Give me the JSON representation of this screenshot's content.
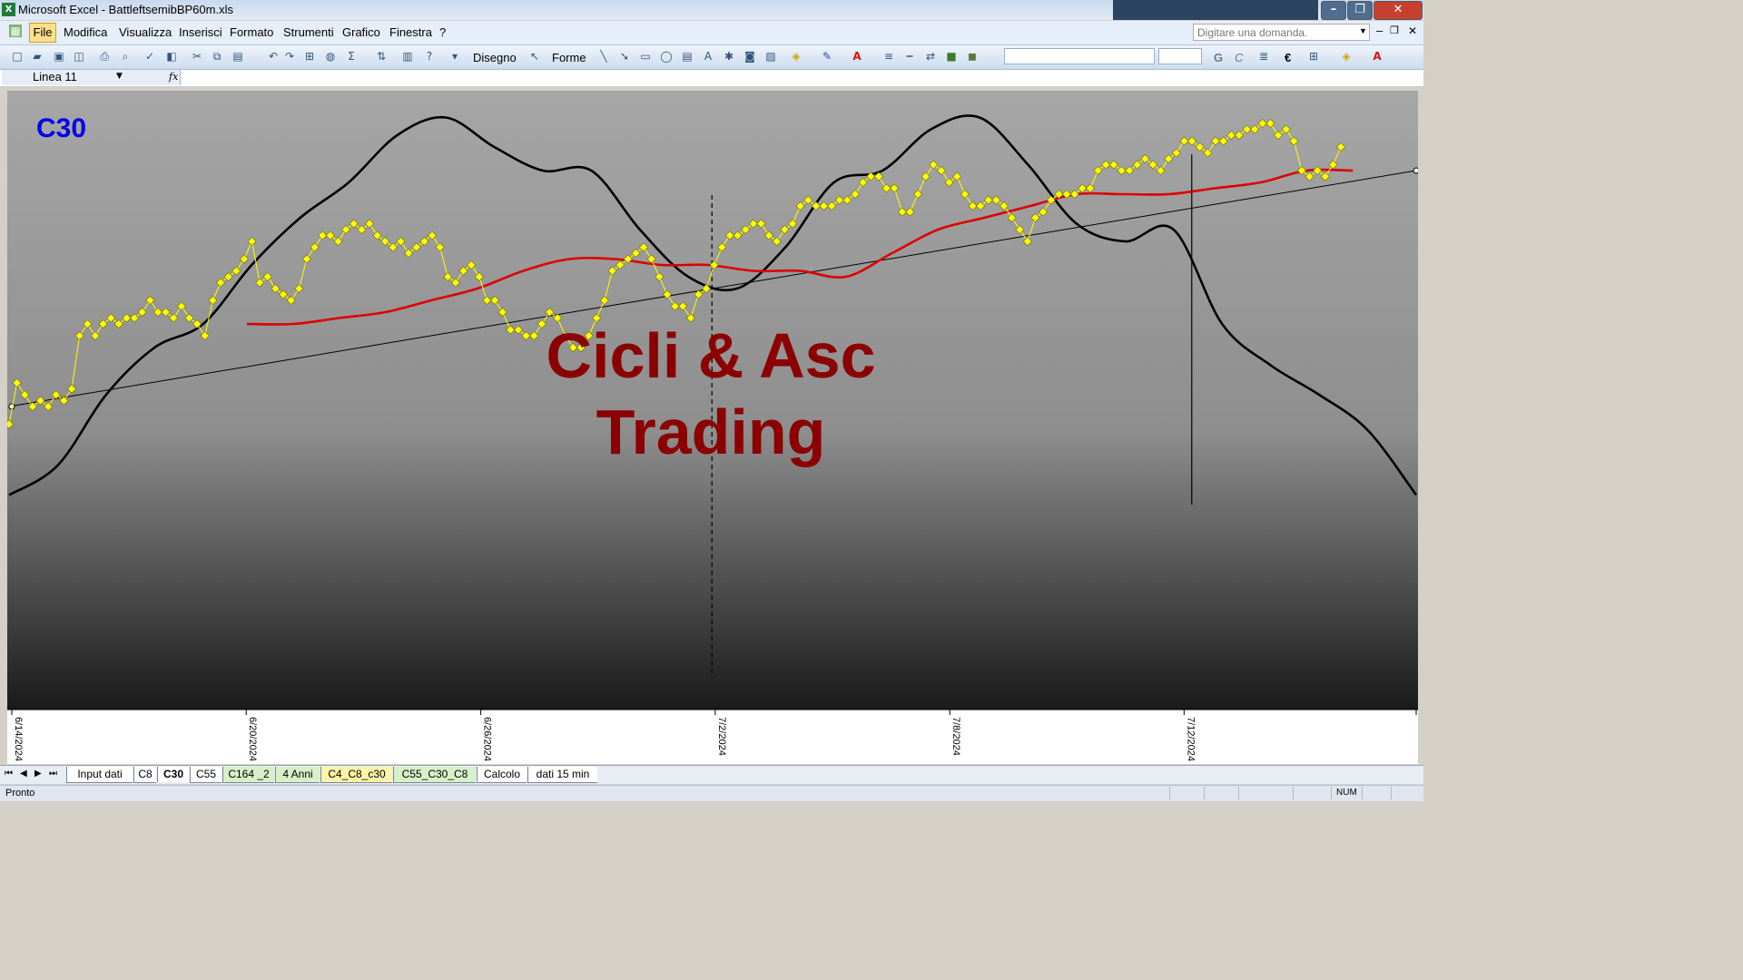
{
  "window": {
    "title": "Microsoft Excel - BattleftsemibBP60m.xls",
    "icon": "excel-icon",
    "controls": [
      "minimize-icon",
      "restore-icon",
      "close-icon"
    ]
  },
  "menubar": {
    "items": [
      "File",
      "Modifica",
      "Visualizza",
      "Inserisci",
      "Formato",
      "Strumenti",
      "Grafico",
      "Finestra",
      "?"
    ],
    "ask_placeholder": "Digitare una domanda."
  },
  "toolbar": {
    "draw_label": "Disegno",
    "shapes_label": "Forme",
    "bold_label": "G",
    "italic_label": "C",
    "euro_label": "€"
  },
  "formula_bar": {
    "name_box": "Linea 11",
    "fx_label": "fx"
  },
  "chart_data": {
    "type": "line",
    "title": "C30",
    "watermark": [
      "Cicli & Asc",
      "Trading"
    ],
    "x_tick_labels": [
      "6/14/2024",
      "6/20/2024",
      "6/26/2024",
      "7/2/2024",
      "7/8/2024",
      "7/12/2024"
    ],
    "colors": {
      "price": "#ffff00",
      "average": "#dd0000",
      "cycle": "#000000",
      "trendline": "#000000",
      "title": "#0000ee",
      "watermark": "#8b0000"
    },
    "price": [
      0.45,
      0.52,
      0.5,
      0.48,
      0.49,
      0.48,
      0.5,
      0.49,
      0.51,
      0.6,
      0.62,
      0.6,
      0.62,
      0.63,
      0.62,
      0.63,
      0.63,
      0.64,
      0.66,
      0.64,
      0.64,
      0.63,
      0.65,
      0.63,
      0.62,
      0.6,
      0.66,
      0.69,
      0.7,
      0.71,
      0.73,
      0.76,
      0.69,
      0.7,
      0.68,
      0.67,
      0.66,
      0.68,
      0.73,
      0.75,
      0.77,
      0.77,
      0.76,
      0.78,
      0.79,
      0.78,
      0.79,
      0.77,
      0.76,
      0.75,
      0.76,
      0.74,
      0.75,
      0.76,
      0.77,
      0.75,
      0.7,
      0.69,
      0.71,
      0.72,
      0.7,
      0.66,
      0.66,
      0.64,
      0.61,
      0.61,
      0.6,
      0.6,
      0.62,
      0.64,
      0.63,
      0.6,
      0.58,
      0.58,
      0.6,
      0.63,
      0.66,
      0.71,
      0.72,
      0.73,
      0.74,
      0.75,
      0.73,
      0.7,
      0.67,
      0.65,
      0.65,
      0.63,
      0.67,
      0.68,
      0.72,
      0.75,
      0.77,
      0.77,
      0.78,
      0.79,
      0.79,
      0.77,
      0.76,
      0.78,
      0.79,
      0.82,
      0.83,
      0.82,
      0.82,
      0.82,
      0.83,
      0.83,
      0.84,
      0.86,
      0.87,
      0.87,
      0.85,
      0.85,
      0.81,
      0.81,
      0.84,
      0.87,
      0.89,
      0.88,
      0.86,
      0.87,
      0.84,
      0.82,
      0.82,
      0.83,
      0.83,
      0.82,
      0.8,
      0.78,
      0.76,
      0.8,
      0.81,
      0.83,
      0.84,
      0.84,
      0.84,
      0.85,
      0.85,
      0.88,
      0.89,
      0.89,
      0.88,
      0.88,
      0.89,
      0.9,
      0.89,
      0.88,
      0.9,
      0.91,
      0.93,
      0.93,
      0.92,
      0.91,
      0.93,
      0.93,
      0.94,
      0.94,
      0.95,
      0.95,
      0.96,
      0.96,
      0.94,
      0.95,
      0.93,
      0.88,
      0.87,
      0.88,
      0.87,
      0.89,
      0.92
    ],
    "moving_average": [
      0.62,
      0.62,
      0.63,
      0.64,
      0.66,
      0.68,
      0.71,
      0.73,
      0.73,
      0.72,
      0.72,
      0.71,
      0.71,
      0.7,
      0.74,
      0.78,
      0.8,
      0.82,
      0.84,
      0.84,
      0.84,
      0.85,
      0.86,
      0.88,
      0.88
    ],
    "cycle": [
      0.33,
      0.38,
      0.5,
      0.58,
      0.62,
      0.72,
      0.8,
      0.86,
      0.94,
      0.97,
      0.92,
      0.88,
      0.88,
      0.78,
      0.7,
      0.68,
      0.75,
      0.86,
      0.88,
      0.95,
      0.97,
      0.89,
      0.79,
      0.76,
      0.78,
      0.62,
      0.55,
      0.5,
      0.44,
      0.33
    ],
    "trendline": [
      0.48,
      0.88
    ],
    "ylim": [
      0,
      1
    ],
    "grid": false,
    "legend": "none"
  },
  "sheet_tabs": {
    "tabs": [
      {
        "label": "Input dati",
        "active": false,
        "color": "#ffffff"
      },
      {
        "label": "C8",
        "active": false,
        "color": "#ffffff"
      },
      {
        "label": "C30",
        "active": true,
        "color": "#ffffff"
      },
      {
        "label": "C55",
        "active": false,
        "color": "#ffffff"
      },
      {
        "label": "C164 _2",
        "active": false,
        "color": "#d7f0c8"
      },
      {
        "label": "4 Anni",
        "active": false,
        "color": "#d7f0c8"
      },
      {
        "label": "C4_C8_c30",
        "active": false,
        "color": "#fdf4a7"
      },
      {
        "label": "C55_C30_C8",
        "active": false,
        "color": "#d7f0c8"
      },
      {
        "label": "Calcolo",
        "active": false,
        "color": "#ffffff"
      },
      {
        "label": "dati 15 min",
        "active": false,
        "color": "#ffffff"
      }
    ]
  },
  "status": {
    "left": "Pronto",
    "num": "NUM"
  }
}
